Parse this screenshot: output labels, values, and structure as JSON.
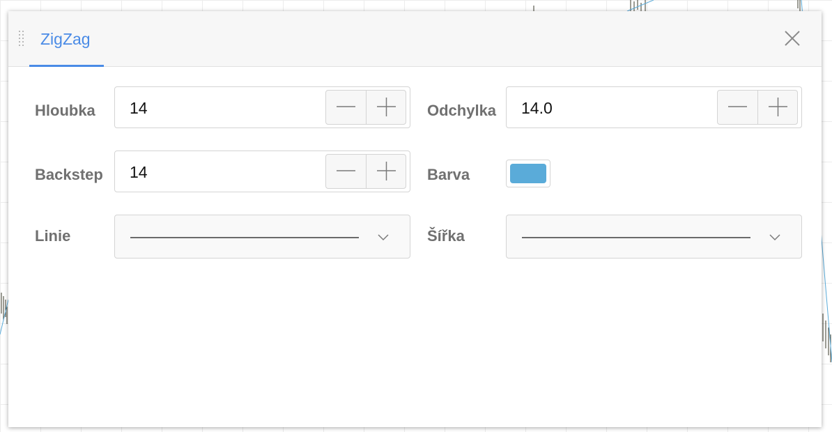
{
  "dialog": {
    "tab_label": "ZigZag",
    "close_icon": "close-icon"
  },
  "fields": {
    "depth": {
      "label": "Hloubka",
      "value": "14"
    },
    "deviation": {
      "label": "Odchylka",
      "value": "14.0"
    },
    "backstep": {
      "label": "Backstep",
      "value": "14"
    },
    "color": {
      "label": "Barva",
      "value": "#5aabd9"
    },
    "line": {
      "label": "Linie",
      "selected": "solid-line"
    },
    "width": {
      "label": "Šířka",
      "selected": "thin-line"
    }
  },
  "colors": {
    "accent": "#4a8be6",
    "label_text": "#707070",
    "border": "#d4d4d4",
    "zigzag_line": "#5aabd9"
  }
}
